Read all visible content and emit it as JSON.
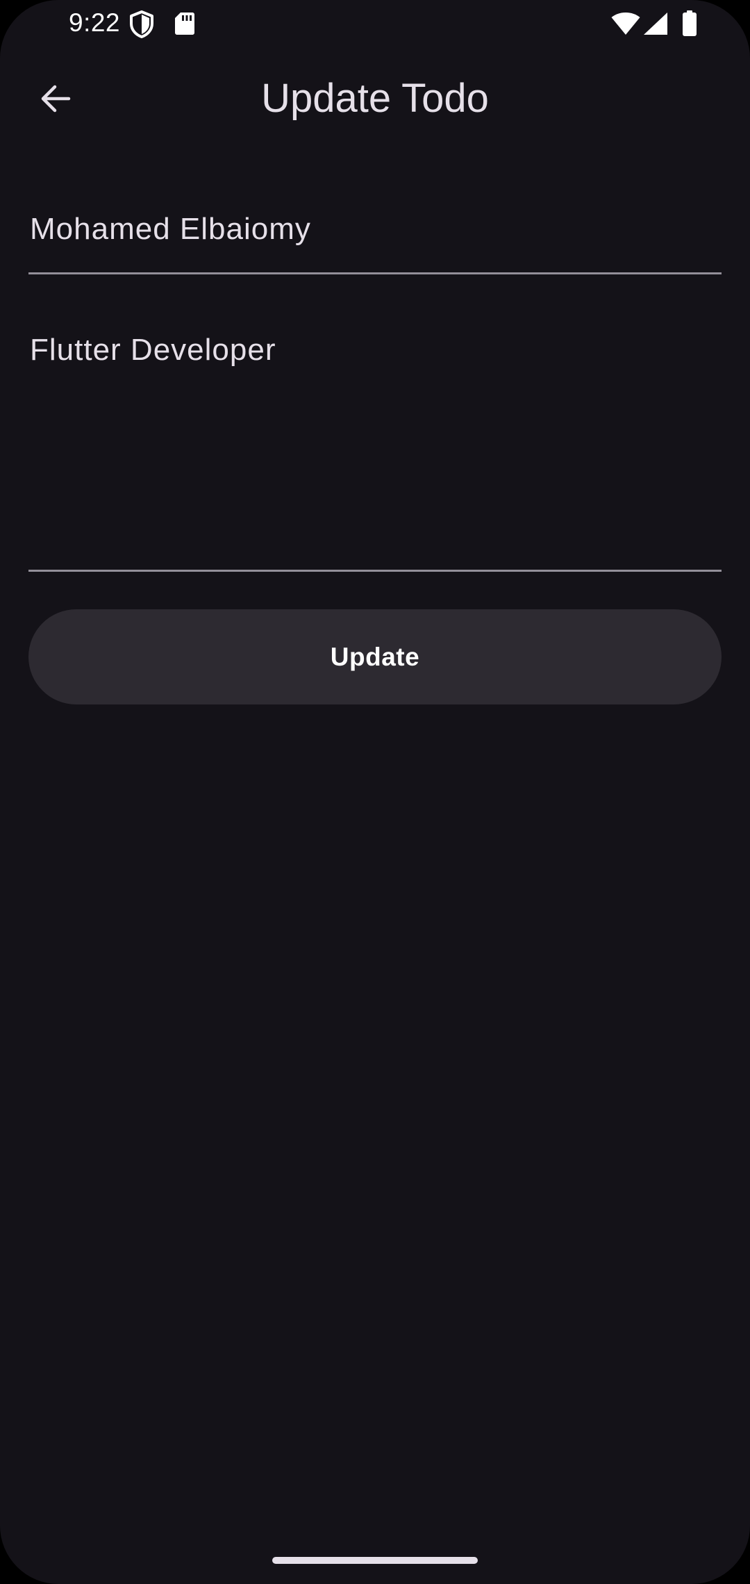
{
  "status_bar": {
    "time": "9:22",
    "icons": [
      "shield-icon",
      "sd-card-icon",
      "wifi-icon",
      "cellular-signal-icon",
      "battery-icon"
    ]
  },
  "app_bar": {
    "title": "Update Todo",
    "back_icon": "arrow-back-icon"
  },
  "form": {
    "name_value": "Mohamed Elbaiomy",
    "description_value": "Flutter Developer",
    "update_label": "Update"
  },
  "colors": {
    "background": "#141218",
    "surface_button": "#2D2A31",
    "on_surface": "#E6E0E9",
    "underline": "#938F99"
  }
}
